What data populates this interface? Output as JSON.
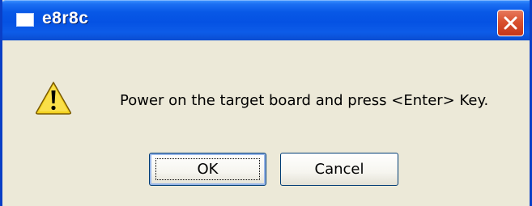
{
  "window": {
    "title": "e8r8c",
    "close_icon": "close-x-icon",
    "accent_color": "#0a54e3",
    "close_color": "#d9512f"
  },
  "dialog": {
    "icon": "warning-icon",
    "message": "Power on the target board and press <Enter> Key."
  },
  "buttons": {
    "ok_label": "OK",
    "cancel_label": "Cancel"
  }
}
